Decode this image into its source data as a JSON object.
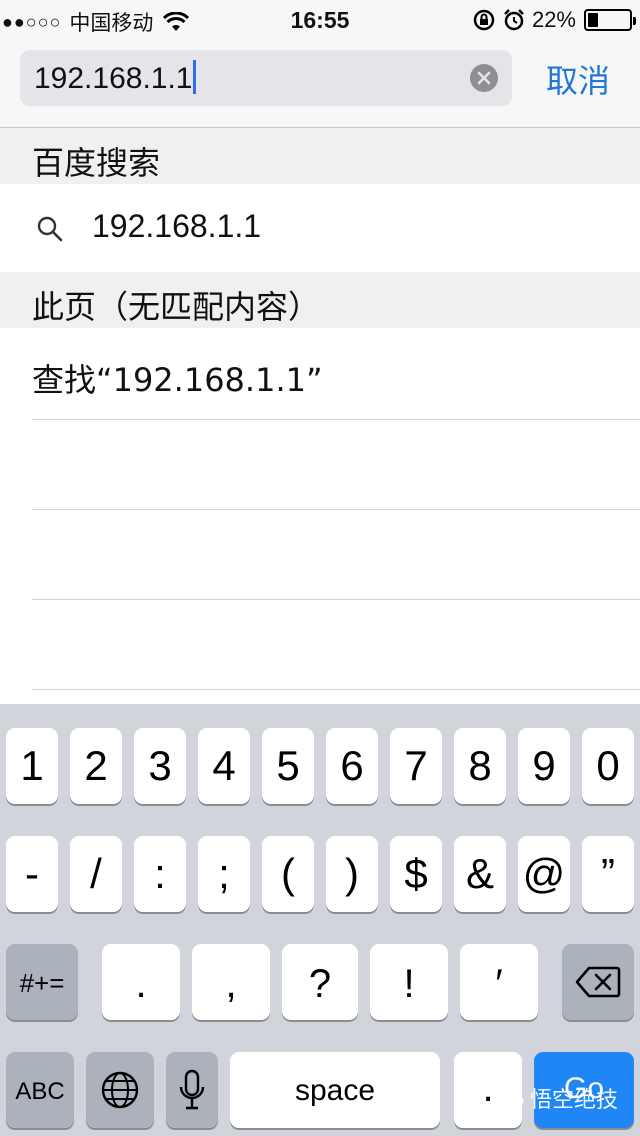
{
  "status_bar": {
    "signal_dots": "●●○○○",
    "carrier": "中国移动",
    "time": "16:55",
    "battery_percent": "22%",
    "battery_level": 0.22,
    "icons": [
      "wifi-icon",
      "rotation-lock-icon",
      "alarm-icon",
      "battery-icon"
    ]
  },
  "search": {
    "value": "192.168.1.1",
    "cancel_label": "取消",
    "icons": [
      "clear-icon"
    ]
  },
  "sections": {
    "baidu_header": "百度搜索",
    "baidu_suggestion": "192.168.1.1",
    "page_header": "此页（无匹配内容）",
    "find_in_page": "查找“192.168.1.1”"
  },
  "keyboard": {
    "row1": [
      "1",
      "2",
      "3",
      "4",
      "5",
      "6",
      "7",
      "8",
      "9",
      "0"
    ],
    "row2": [
      "-",
      "/",
      ":",
      ";",
      "(",
      ")",
      "$",
      "&",
      "@",
      "”"
    ],
    "row3": {
      "symbols_label": "#+=",
      "keys": [
        ".",
        ",",
        "?",
        "!",
        "′"
      ],
      "delete_icon": "backspace-icon"
    },
    "row4": {
      "abc_label": "ABC",
      "globe_icon": "globe-icon",
      "mic_icon": "microphone-icon",
      "space_label": "space",
      "dot_label": ".",
      "go_label": "Go"
    }
  },
  "watermark": {
    "text": "悟空绝技",
    "icon": "wechat-icon"
  }
}
